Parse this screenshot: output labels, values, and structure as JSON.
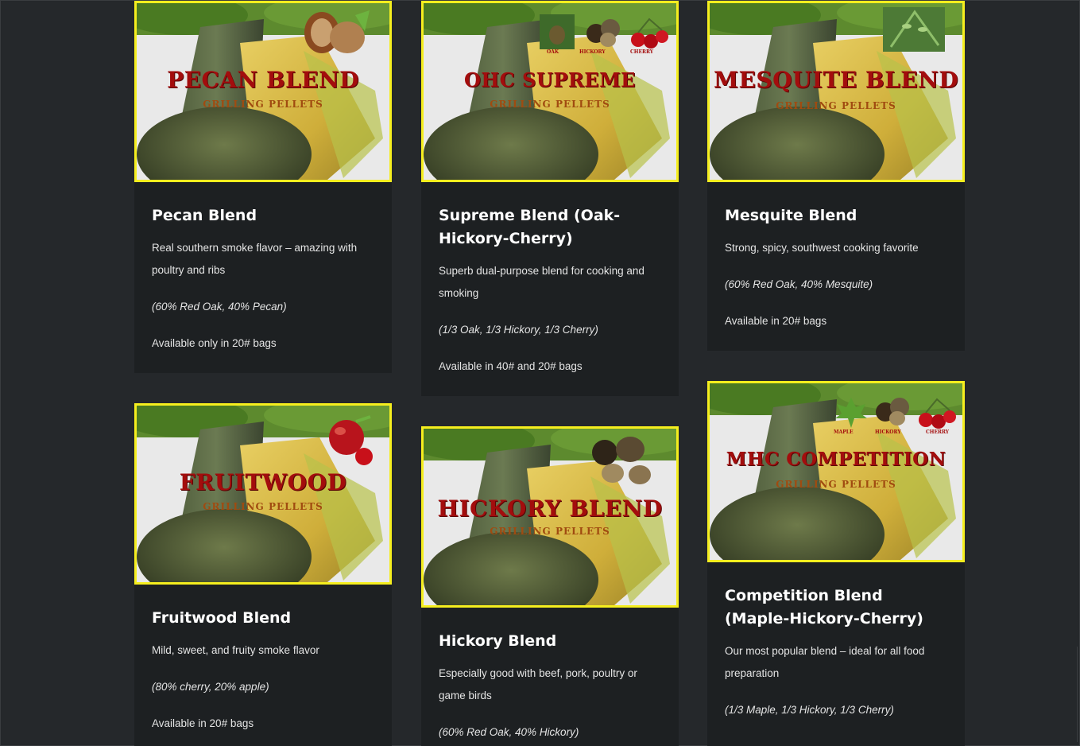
{
  "cards": [
    {
      "image": {
        "title": "PECAN BLEND",
        "subtitle": "GRILLING PELLETS",
        "fruits": []
      },
      "title": "Pecan Blend",
      "description": "Real southern smoke flavor – amazing with poultry and ribs",
      "composition": "(60% Red Oak, 40% Pecan)",
      "availability": "Available only in 20# bags"
    },
    {
      "image": {
        "title": "OHC SUPREME",
        "subtitle": "GRILLING PELLETS",
        "fruits": [
          "OAK",
          "HICKORY",
          "CHERRY"
        ]
      },
      "title": "Supreme Blend (Oak-Hickory-Cherry)",
      "description": "Superb dual-purpose blend for cooking and smoking",
      "composition": "(1/3 Oak, 1/3 Hickory, 1/3 Cherry)",
      "availability": "Available in 40# and 20# bags"
    },
    {
      "image": {
        "title": "MESQUITE BLEND",
        "subtitle": "GRILLING PELLETS",
        "fruits": []
      },
      "title": "Mesquite Blend",
      "description": "Strong, spicy, southwest cooking favorite",
      "composition": "(60% Red Oak, 40% Mesquite)",
      "availability": "Available in 20# bags"
    },
    {
      "image": {
        "title": "FRUITWOOD",
        "subtitle": "GRILLING PELLETS",
        "fruits": []
      },
      "title": "Fruitwood Blend",
      "description": "Mild, sweet, and fruity smoke flavor",
      "composition": "(80% cherry, 20% apple)",
      "availability": "Available in 20# bags"
    },
    {
      "image": {
        "title": "HICKORY BLEND",
        "subtitle": "GRILLING PELLETS",
        "fruits": []
      },
      "title": "Hickory Blend",
      "description": "Especially good with beef, pork, poultry or game birds",
      "composition": "(60% Red Oak, 40% Hickory)",
      "availability": ""
    },
    {
      "image": {
        "title": "MHC COMPETITION",
        "subtitle": "GRILLING PELLETS",
        "fruits": [
          "MAPLE",
          "HICKORY",
          "CHERRY"
        ]
      },
      "title": "Competition Blend (Maple-Hickory-Cherry)",
      "description": "Our most popular blend – ideal for all food preparation",
      "composition": "(1/3 Maple, 1/3 Hickory, 1/3 Cherry)",
      "availability": ""
    }
  ],
  "colors": {
    "page_bg": "#25282b",
    "card_bg": "#1d2022",
    "image_border": "#f5ee1e",
    "label_red": "#a30d0d"
  }
}
